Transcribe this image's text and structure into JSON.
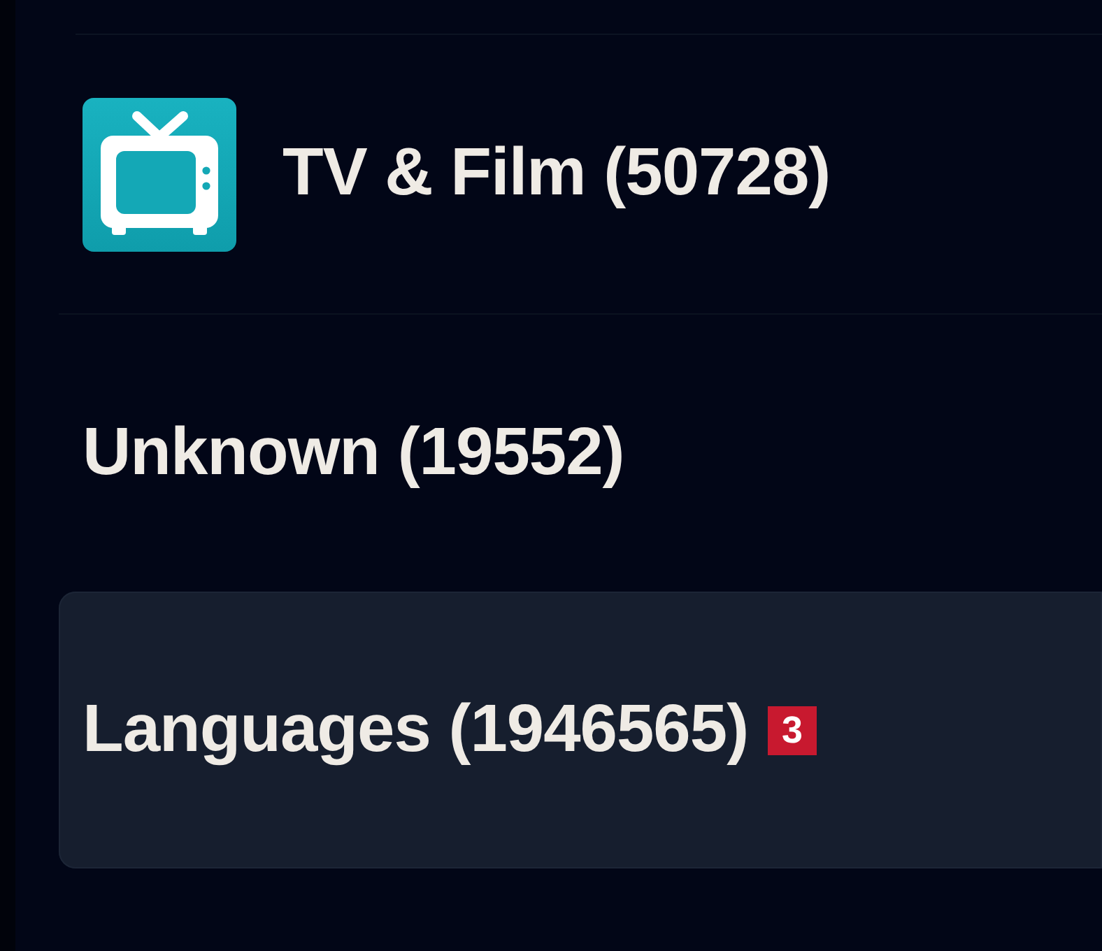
{
  "categories": [
    {
      "kind": "icon",
      "label": "TV & Film (50728)",
      "selected": false
    },
    {
      "kind": "plain",
      "label": "Unknown (19552)",
      "selected": false
    },
    {
      "kind": "plain",
      "label": "Languages (1946565)",
      "selected": true,
      "badge": "3"
    }
  ]
}
